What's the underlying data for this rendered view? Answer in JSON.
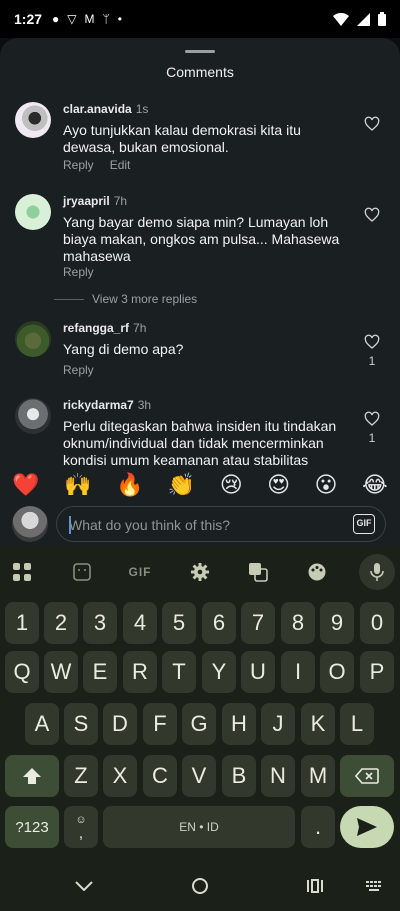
{
  "status": {
    "time": "1:27"
  },
  "sheet": {
    "title": "Comments"
  },
  "comments": [
    {
      "user": "clar.anavida",
      "ago": "1s",
      "text": "Ayo tunjukkan kalau demokrasi kita itu dewasa, bukan emosional.",
      "reply": "Reply",
      "edit": "Edit",
      "likes": ""
    },
    {
      "user": "jryaapril",
      "ago": "7h",
      "text": "Yang bayar demo siapa min? Lumayan loh biaya makan, ongkos am pulsa... Mahasewa mahasewa",
      "reply": "Reply",
      "likes": ""
    },
    {
      "user": "refangga_rf",
      "ago": "7h",
      "text": "Yang di demo apa?",
      "reply": "Reply",
      "likes": "1"
    },
    {
      "user": "rickydarma7",
      "ago": "3h",
      "text": "Perlu ditegaskan bahwa insiden itu tindakan oknum/individual dan tidak mencerminkan kondisi umum keamanan atau stabilitas",
      "likes": "1"
    }
  ],
  "more_replies": "View 3 more replies",
  "emojis": [
    "❤️",
    "🙌",
    "🔥",
    "👏",
    "😢",
    "😍",
    "😮",
    "😂"
  ],
  "input": {
    "placeholder": "What do you think of this?",
    "gif": "GIF"
  },
  "keyboard": {
    "toolbar_gif": "GIF",
    "row_numbers": [
      "1",
      "2",
      "3",
      "4",
      "5",
      "6",
      "7",
      "8",
      "9",
      "0"
    ],
    "row_q": [
      "Q",
      "W",
      "E",
      "R",
      "T",
      "Y",
      "U",
      "I",
      "O",
      "P"
    ],
    "row_a": [
      "A",
      "S",
      "D",
      "F",
      "G",
      "H",
      "J",
      "K",
      "L"
    ],
    "row_z": [
      "Z",
      "X",
      "C",
      "V",
      "B",
      "N",
      "M"
    ],
    "symbols": "?123",
    "comma": ",",
    "space": "EN • ID",
    "period": "."
  }
}
